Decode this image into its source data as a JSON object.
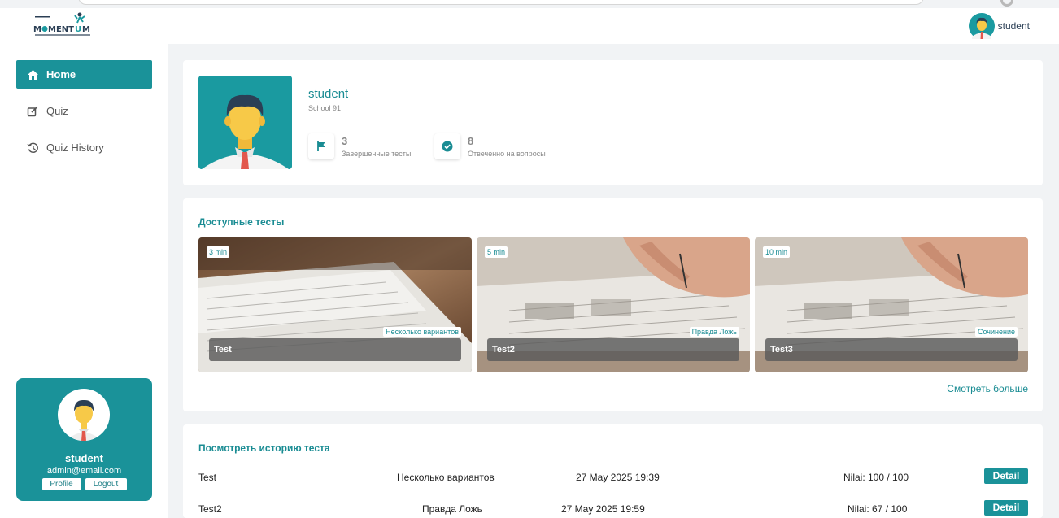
{
  "header": {
    "logo_text": "MOMENTUM",
    "user_name": "student"
  },
  "sidebar": {
    "items": [
      {
        "label": "Home",
        "icon": "home-icon",
        "active": true
      },
      {
        "label": "Quiz",
        "icon": "edit-icon",
        "active": false
      },
      {
        "label": "Quiz History",
        "icon": "history-icon",
        "active": false
      }
    ],
    "profile": {
      "name": "student",
      "email": "admin@email.com",
      "profile_label": "Profile",
      "logout_label": "Logout"
    }
  },
  "profile_summary": {
    "name": "student",
    "school": "School 91",
    "stats": [
      {
        "value": "3",
        "label": "Завершенные тесты",
        "icon": "flag-icon"
      },
      {
        "value": "8",
        "label": "Отвеченно на вопросы",
        "icon": "check-circle-icon"
      }
    ]
  },
  "available_tests": {
    "title": "Доступные тесты",
    "tests": [
      {
        "name": "Test",
        "duration": "3 min",
        "type": "Несколько вариантов"
      },
      {
        "name": "Test2",
        "duration": "5 min",
        "type": "Правда Ложь"
      },
      {
        "name": "Test3",
        "duration": "10 min",
        "type": "Сочинение"
      }
    ],
    "see_more": "Смотреть больше"
  },
  "history": {
    "title": "Посмотреть историю теста",
    "rows": [
      {
        "name": "Test",
        "type": "Несколько вариантов",
        "date": "27 May 2025 19:39",
        "score": "Nilai: 100 / 100",
        "action": "Detail"
      },
      {
        "name": "Test2",
        "type": "Правда Ложь",
        "date": "27 May 2025 19:59",
        "score": "Nilai: 67 / 100",
        "action": "Detail"
      }
    ]
  },
  "colors": {
    "accent": "#1a9299",
    "accent_text": "#1a8c93",
    "background": "#f1f3f5"
  }
}
